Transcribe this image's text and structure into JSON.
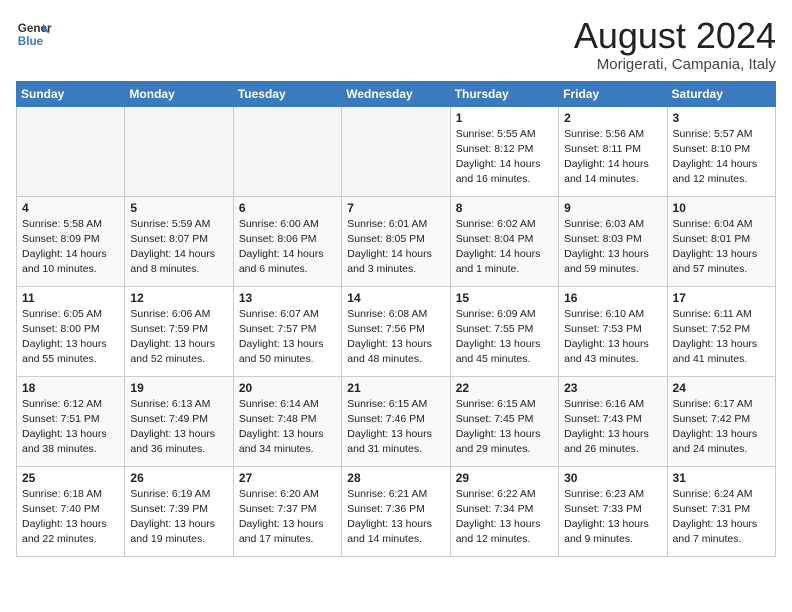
{
  "header": {
    "logo_line1": "General",
    "logo_line2": "Blue",
    "month_year": "August 2024",
    "location": "Morigerati, Campania, Italy"
  },
  "weekdays": [
    "Sunday",
    "Monday",
    "Tuesday",
    "Wednesday",
    "Thursday",
    "Friday",
    "Saturday"
  ],
  "weeks": [
    [
      {
        "day": "",
        "info": ""
      },
      {
        "day": "",
        "info": ""
      },
      {
        "day": "",
        "info": ""
      },
      {
        "day": "",
        "info": ""
      },
      {
        "day": "1",
        "info": "Sunrise: 5:55 AM\nSunset: 8:12 PM\nDaylight: 14 hours\nand 16 minutes."
      },
      {
        "day": "2",
        "info": "Sunrise: 5:56 AM\nSunset: 8:11 PM\nDaylight: 14 hours\nand 14 minutes."
      },
      {
        "day": "3",
        "info": "Sunrise: 5:57 AM\nSunset: 8:10 PM\nDaylight: 14 hours\nand 12 minutes."
      }
    ],
    [
      {
        "day": "4",
        "info": "Sunrise: 5:58 AM\nSunset: 8:09 PM\nDaylight: 14 hours\nand 10 minutes."
      },
      {
        "day": "5",
        "info": "Sunrise: 5:59 AM\nSunset: 8:07 PM\nDaylight: 14 hours\nand 8 minutes."
      },
      {
        "day": "6",
        "info": "Sunrise: 6:00 AM\nSunset: 8:06 PM\nDaylight: 14 hours\nand 6 minutes."
      },
      {
        "day": "7",
        "info": "Sunrise: 6:01 AM\nSunset: 8:05 PM\nDaylight: 14 hours\nand 3 minutes."
      },
      {
        "day": "8",
        "info": "Sunrise: 6:02 AM\nSunset: 8:04 PM\nDaylight: 14 hours\nand 1 minute."
      },
      {
        "day": "9",
        "info": "Sunrise: 6:03 AM\nSunset: 8:03 PM\nDaylight: 13 hours\nand 59 minutes."
      },
      {
        "day": "10",
        "info": "Sunrise: 6:04 AM\nSunset: 8:01 PM\nDaylight: 13 hours\nand 57 minutes."
      }
    ],
    [
      {
        "day": "11",
        "info": "Sunrise: 6:05 AM\nSunset: 8:00 PM\nDaylight: 13 hours\nand 55 minutes."
      },
      {
        "day": "12",
        "info": "Sunrise: 6:06 AM\nSunset: 7:59 PM\nDaylight: 13 hours\nand 52 minutes."
      },
      {
        "day": "13",
        "info": "Sunrise: 6:07 AM\nSunset: 7:57 PM\nDaylight: 13 hours\nand 50 minutes."
      },
      {
        "day": "14",
        "info": "Sunrise: 6:08 AM\nSunset: 7:56 PM\nDaylight: 13 hours\nand 48 minutes."
      },
      {
        "day": "15",
        "info": "Sunrise: 6:09 AM\nSunset: 7:55 PM\nDaylight: 13 hours\nand 45 minutes."
      },
      {
        "day": "16",
        "info": "Sunrise: 6:10 AM\nSunset: 7:53 PM\nDaylight: 13 hours\nand 43 minutes."
      },
      {
        "day": "17",
        "info": "Sunrise: 6:11 AM\nSunset: 7:52 PM\nDaylight: 13 hours\nand 41 minutes."
      }
    ],
    [
      {
        "day": "18",
        "info": "Sunrise: 6:12 AM\nSunset: 7:51 PM\nDaylight: 13 hours\nand 38 minutes."
      },
      {
        "day": "19",
        "info": "Sunrise: 6:13 AM\nSunset: 7:49 PM\nDaylight: 13 hours\nand 36 minutes."
      },
      {
        "day": "20",
        "info": "Sunrise: 6:14 AM\nSunset: 7:48 PM\nDaylight: 13 hours\nand 34 minutes."
      },
      {
        "day": "21",
        "info": "Sunrise: 6:15 AM\nSunset: 7:46 PM\nDaylight: 13 hours\nand 31 minutes."
      },
      {
        "day": "22",
        "info": "Sunrise: 6:15 AM\nSunset: 7:45 PM\nDaylight: 13 hours\nand 29 minutes."
      },
      {
        "day": "23",
        "info": "Sunrise: 6:16 AM\nSunset: 7:43 PM\nDaylight: 13 hours\nand 26 minutes."
      },
      {
        "day": "24",
        "info": "Sunrise: 6:17 AM\nSunset: 7:42 PM\nDaylight: 13 hours\nand 24 minutes."
      }
    ],
    [
      {
        "day": "25",
        "info": "Sunrise: 6:18 AM\nSunset: 7:40 PM\nDaylight: 13 hours\nand 22 minutes."
      },
      {
        "day": "26",
        "info": "Sunrise: 6:19 AM\nSunset: 7:39 PM\nDaylight: 13 hours\nand 19 minutes."
      },
      {
        "day": "27",
        "info": "Sunrise: 6:20 AM\nSunset: 7:37 PM\nDaylight: 13 hours\nand 17 minutes."
      },
      {
        "day": "28",
        "info": "Sunrise: 6:21 AM\nSunset: 7:36 PM\nDaylight: 13 hours\nand 14 minutes."
      },
      {
        "day": "29",
        "info": "Sunrise: 6:22 AM\nSunset: 7:34 PM\nDaylight: 13 hours\nand 12 minutes."
      },
      {
        "day": "30",
        "info": "Sunrise: 6:23 AM\nSunset: 7:33 PM\nDaylight: 13 hours\nand 9 minutes."
      },
      {
        "day": "31",
        "info": "Sunrise: 6:24 AM\nSunset: 7:31 PM\nDaylight: 13 hours\nand 7 minutes."
      }
    ]
  ]
}
